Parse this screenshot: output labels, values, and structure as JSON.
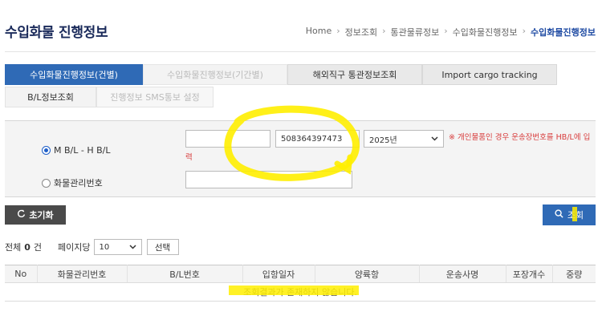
{
  "page": {
    "title": "수입화물 진행정보",
    "breadcrumb": [
      "Home",
      "정보조회",
      "통관물류정보",
      "수입화물진행정보",
      "수입화물진행정보"
    ],
    "breadcrumb_sep": "›"
  },
  "tabs": {
    "row1": [
      {
        "label": "수입화물진행정보(건별)",
        "state": "active"
      },
      {
        "label": "수입화물진행정보(기간별)",
        "state": "disabled"
      },
      {
        "label": "해외직구 통관정보조회",
        "state": "grey"
      },
      {
        "label": "Import cargo tracking",
        "state": "grey"
      }
    ],
    "row2": [
      {
        "label": "B/L정보조회",
        "state": "normal"
      },
      {
        "label": "진행정보 SMS통보 설정",
        "state": "disabled"
      }
    ]
  },
  "search": {
    "radio_mbl_label": "M B/L - H B/L",
    "radio_mbl_checked": true,
    "radio_cargo_label": "화물관리번호",
    "radio_cargo_checked": false,
    "mbl_value": "",
    "hbl_value": "508364397473",
    "year_value": "2025년",
    "notice_line1": "※ 개인물품인 경우 운송장번호를 HB/L에 입",
    "notice_line2": "력",
    "cargo_value": ""
  },
  "buttons": {
    "reset_icon": "refresh-icon",
    "reset_label": "초기화",
    "search_icon": "search-icon",
    "search_label": "조회",
    "choose_label": "선택"
  },
  "results": {
    "total_prefix": "전체",
    "total_count": "0",
    "total_suffix": "건",
    "per_page_label": "페이지당",
    "per_page_value": "10",
    "columns": [
      "No",
      "화물관리번호",
      "B/L번호",
      "입항일자",
      "양륙항",
      "운송사명",
      "포장개수",
      "중량"
    ],
    "empty_message": "조회결과가 존재하지 않습니다."
  },
  "colors": {
    "primary": "#2f6ab6",
    "title": "#1a2a5a",
    "notice": "#d83c3c",
    "highlight": "#ffee00"
  }
}
